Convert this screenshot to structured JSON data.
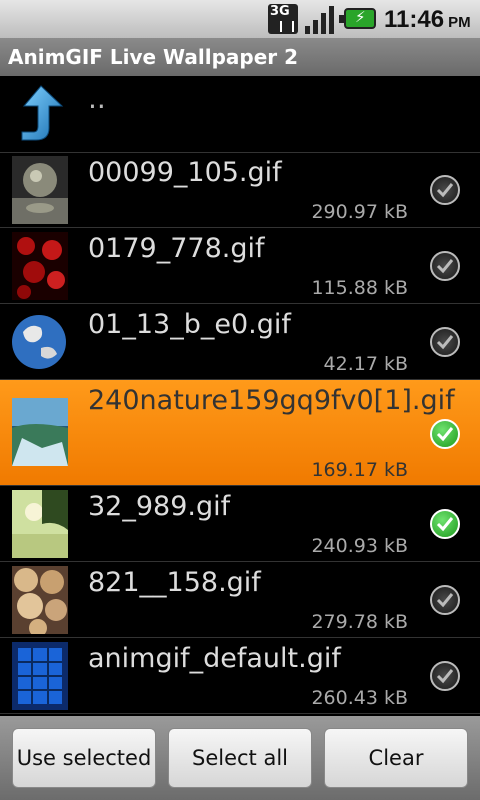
{
  "status_bar": {
    "network": "3G",
    "time": "11:46",
    "ampm": "PM"
  },
  "title": "AnimGIF Live Wallpaper 2",
  "parent": {
    "label": ".."
  },
  "files": [
    {
      "name": "00099_105.gif",
      "size": "290.97 kB",
      "checked": false,
      "highlighted": false
    },
    {
      "name": "0179_778.gif",
      "size": "115.88 kB",
      "checked": false,
      "highlighted": false
    },
    {
      "name": "01_13_b_e0.gif",
      "size": "42.17 kB",
      "checked": false,
      "highlighted": false
    },
    {
      "name": "240nature159gq9fv0[1].gif",
      "size": "169.17 kB",
      "checked": true,
      "highlighted": true
    },
    {
      "name": "32_989.gif",
      "size": "240.93 kB",
      "checked": true,
      "highlighted": false
    },
    {
      "name": "821__158.gif",
      "size": "279.78 kB",
      "checked": false,
      "highlighted": false
    },
    {
      "name": "animgif_default.gif",
      "size": "260.43 kB",
      "checked": false,
      "highlighted": false
    }
  ],
  "buttons": {
    "use_selected": "Use selected",
    "select_all": "Select all",
    "clear": "Clear"
  },
  "colors": {
    "highlight": "#f58a0b",
    "check_on": "#2bb52b"
  }
}
